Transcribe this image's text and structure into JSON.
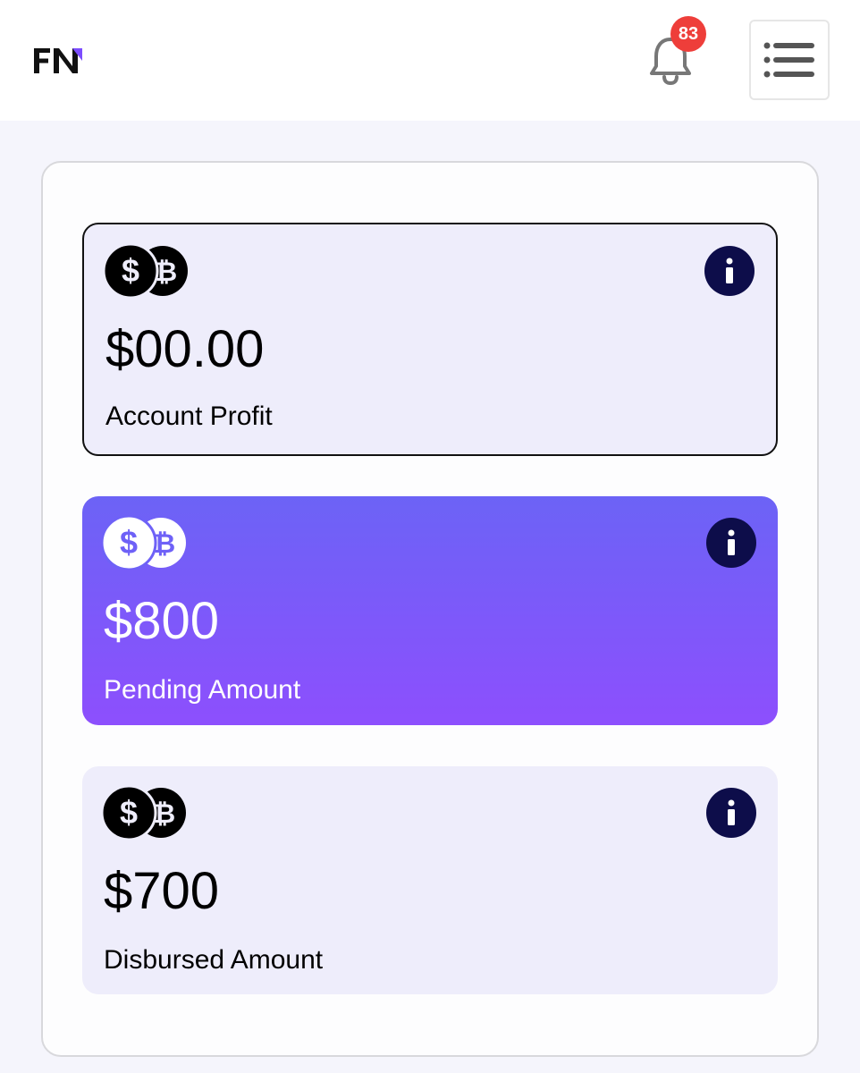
{
  "header": {
    "logo_text": "FN",
    "notification_count": "83"
  },
  "cards": [
    {
      "amount": "$00.00",
      "label": "Account Profit",
      "style": "outlined"
    },
    {
      "amount": "$800",
      "label": "Pending Amount",
      "style": "gradient"
    },
    {
      "amount": "$700",
      "label": "Disbursed Amount",
      "style": "light"
    }
  ],
  "colors": {
    "badge": "#ee3e3a",
    "info_button": "#0d0d4a",
    "card_light": "#eeedfb",
    "gradient_start": "#6c63f6",
    "gradient_end": "#8d4ffd",
    "logo_accent": "#7c4dff"
  },
  "icons": {
    "coins": "dollar-bitcoin-coins-icon",
    "info": "info-icon",
    "bell": "bell-icon",
    "menu": "hamburger-menu-icon"
  }
}
